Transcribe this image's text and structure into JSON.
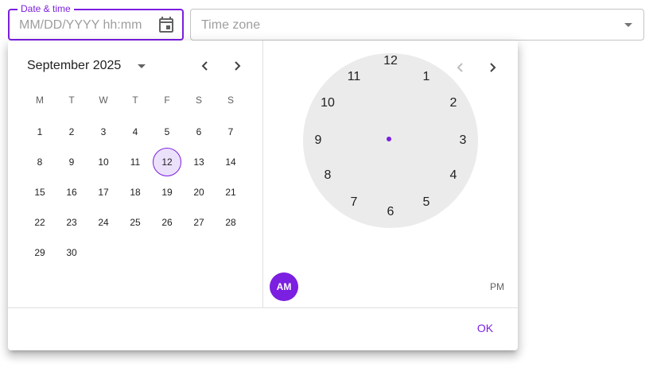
{
  "date_field": {
    "label": "Date & time",
    "placeholder": "MM/DD/YYYY hh:mm",
    "icon": "calendar-icon"
  },
  "timezone_field": {
    "placeholder": "Time zone",
    "icon": "dropdown-arrow-icon"
  },
  "calendar": {
    "month_label": "September 2025",
    "weekdays": [
      "M",
      "T",
      "W",
      "T",
      "F",
      "S",
      "S"
    ],
    "weeks": [
      [
        "1",
        "2",
        "3",
        "4",
        "5",
        "6",
        "7"
      ],
      [
        "8",
        "9",
        "10",
        "11",
        "12",
        "13",
        "14"
      ],
      [
        "15",
        "16",
        "17",
        "18",
        "19",
        "20",
        "21"
      ],
      [
        "22",
        "23",
        "24",
        "25",
        "26",
        "27",
        "28"
      ],
      [
        "29",
        "30"
      ]
    ],
    "selected_day": "12",
    "prev_icon": "chevron-left-icon",
    "next_icon": "chevron-right-icon"
  },
  "clock": {
    "numbers": [
      "12",
      "1",
      "2",
      "3",
      "4",
      "5",
      "6",
      "7",
      "8",
      "9",
      "10",
      "11"
    ],
    "prev_icon": "chevron-left-icon",
    "next_icon": "chevron-right-icon"
  },
  "am_label": "AM",
  "pm_label": "PM",
  "ok_label": "OK",
  "colors": {
    "accent": "#7b1fe0",
    "selected_day_bg": "#ece1fb",
    "clock_face": "#ebebeb"
  }
}
